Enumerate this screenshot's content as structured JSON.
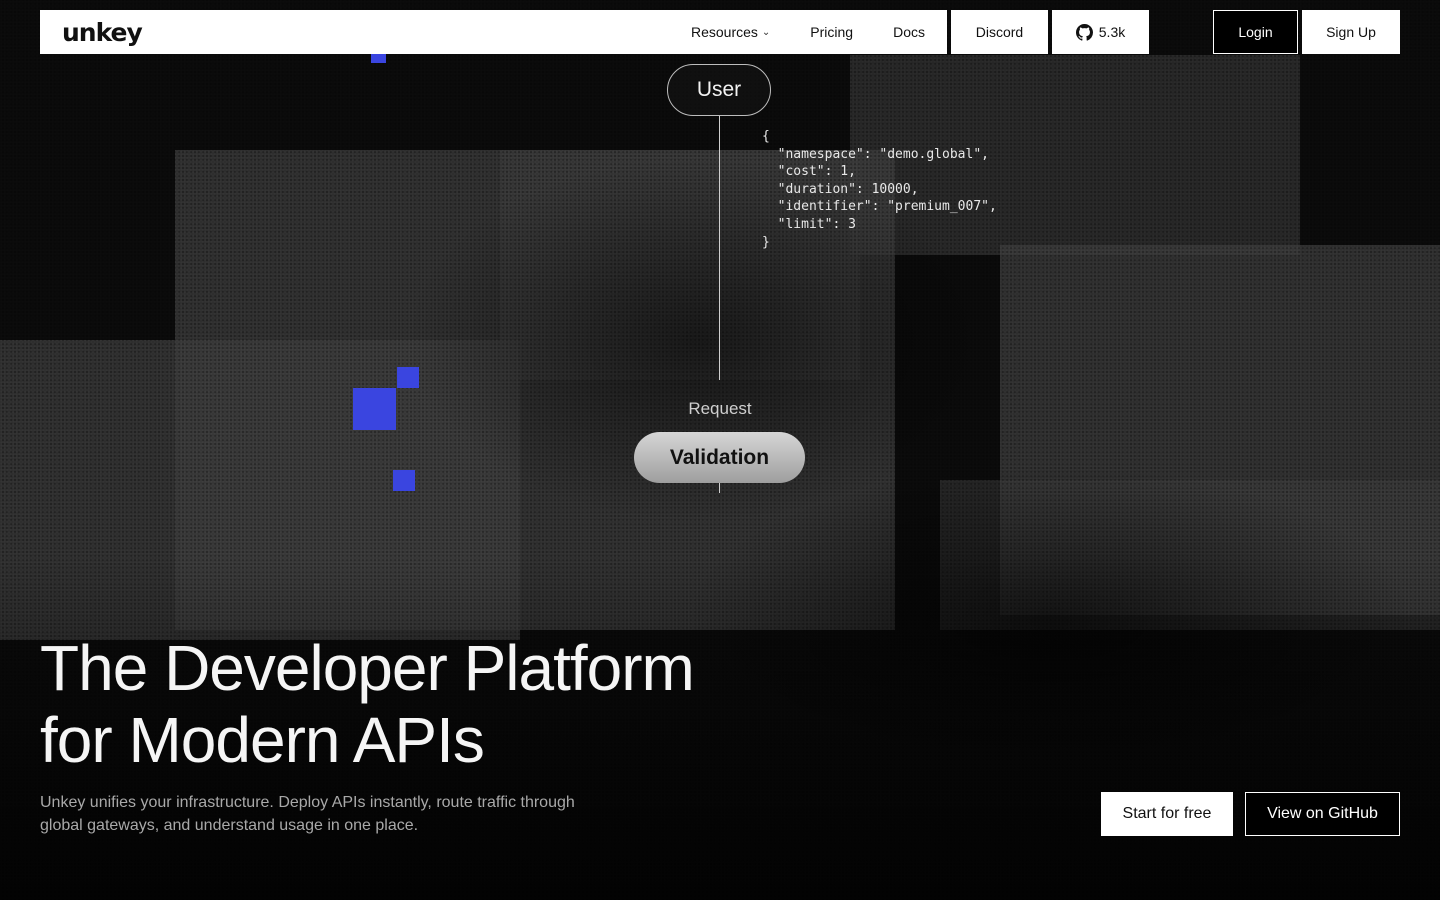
{
  "nav": {
    "logo": "unkey",
    "links": [
      {
        "label": "Resources",
        "has_dropdown": true
      },
      {
        "label": "Pricing"
      },
      {
        "label": "Docs"
      }
    ],
    "discord_label": "Discord",
    "github_stars": "5.3k",
    "login_label": "Login",
    "signup_label": "Sign Up"
  },
  "diagram": {
    "user_label": "User",
    "request_json": "{\n  \"namespace\": \"demo.global\",\n  \"cost\": 1,\n  \"duration\": 10000,\n  \"identifier\": \"premium_007\",\n  \"limit\": 3\n}",
    "request_label": "Request",
    "validation_label": "Validation"
  },
  "hero": {
    "headline_line1": "The Developer Platform",
    "headline_line2": "for Modern APIs",
    "subtext": "Unkey unifies your infrastructure. Deploy APIs instantly, route traffic through global gateways, and understand usage in one place.",
    "primary_cta": "Start for free",
    "secondary_cta": "View on GitHub"
  },
  "colors": {
    "accent_blue": "#3a45e0",
    "background": "#0a0a0a",
    "nav_bg": "#ffffff"
  }
}
